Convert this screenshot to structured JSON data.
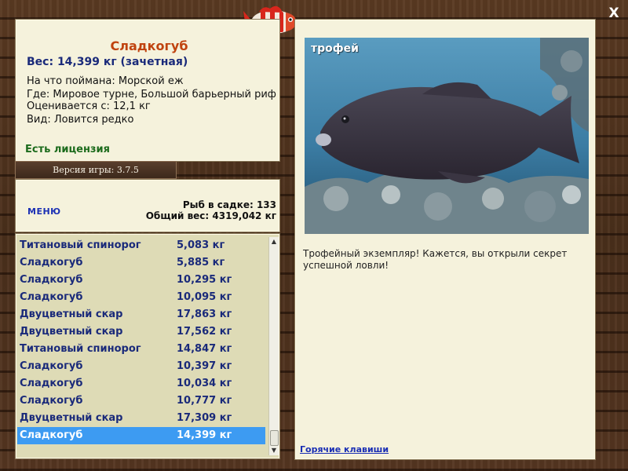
{
  "window": {
    "close_label": "X"
  },
  "fish_info": {
    "name": "Сладкогуб",
    "weight": "Вес: 14,399 кг (зачетная)",
    "caught_on": "На что поймана: Морской еж",
    "location": "Где: Мировое турне, Большой барьерный риф",
    "valued_from": "Оценивается с: 12,1 кг",
    "kind": "Вид: Ловится редко",
    "license": "Есть лицензия"
  },
  "version": {
    "label": "Версия игры: 3.7.5"
  },
  "catch": {
    "menu_label": "МЕНЮ",
    "fish_count": "Рыб в садке: 133",
    "total_weight": "Общий вес: 4319,042 кг",
    "rows": [
      {
        "name": "Титановый спинорог",
        "weight": "5,083 кг"
      },
      {
        "name": "Сладкогуб",
        "weight": "5,885 кг"
      },
      {
        "name": "Сладкогуб",
        "weight": "10,295 кг"
      },
      {
        "name": "Сладкогуб",
        "weight": "10,095 кг"
      },
      {
        "name": "Двуцветный скар",
        "weight": "17,863 кг"
      },
      {
        "name": "Двуцветный скар",
        "weight": "17,562 кг"
      },
      {
        "name": "Титановый спинорог",
        "weight": "14,847 кг"
      },
      {
        "name": "Сладкогуб",
        "weight": "10,397 кг"
      },
      {
        "name": "Сладкогуб",
        "weight": "10,034 кг"
      },
      {
        "name": "Сладкогуб",
        "weight": "10,777 кг"
      },
      {
        "name": "Двуцветный скар",
        "weight": "17,309 кг"
      },
      {
        "name": "Сладкогуб",
        "weight": "14,399 кг",
        "selected": true
      }
    ]
  },
  "trophy": {
    "label": "трофей",
    "description": "Трофейный экземпляр! Кажется, вы открыли секрет успешной ловли!",
    "hotkeys_label": "Горячие клавиши"
  },
  "colors": {
    "fish_name": "#c0430f",
    "weight_text": "#1a2a7a",
    "license_text": "#1c6b1c",
    "link": "#1a2fb4",
    "selected_row": "#3d9bf2",
    "panel_bg": "#f5f2dc",
    "list_bg": "#dedbb6"
  },
  "icons": {
    "logo": "red-striped-fish-icon",
    "close": "close-icon"
  }
}
